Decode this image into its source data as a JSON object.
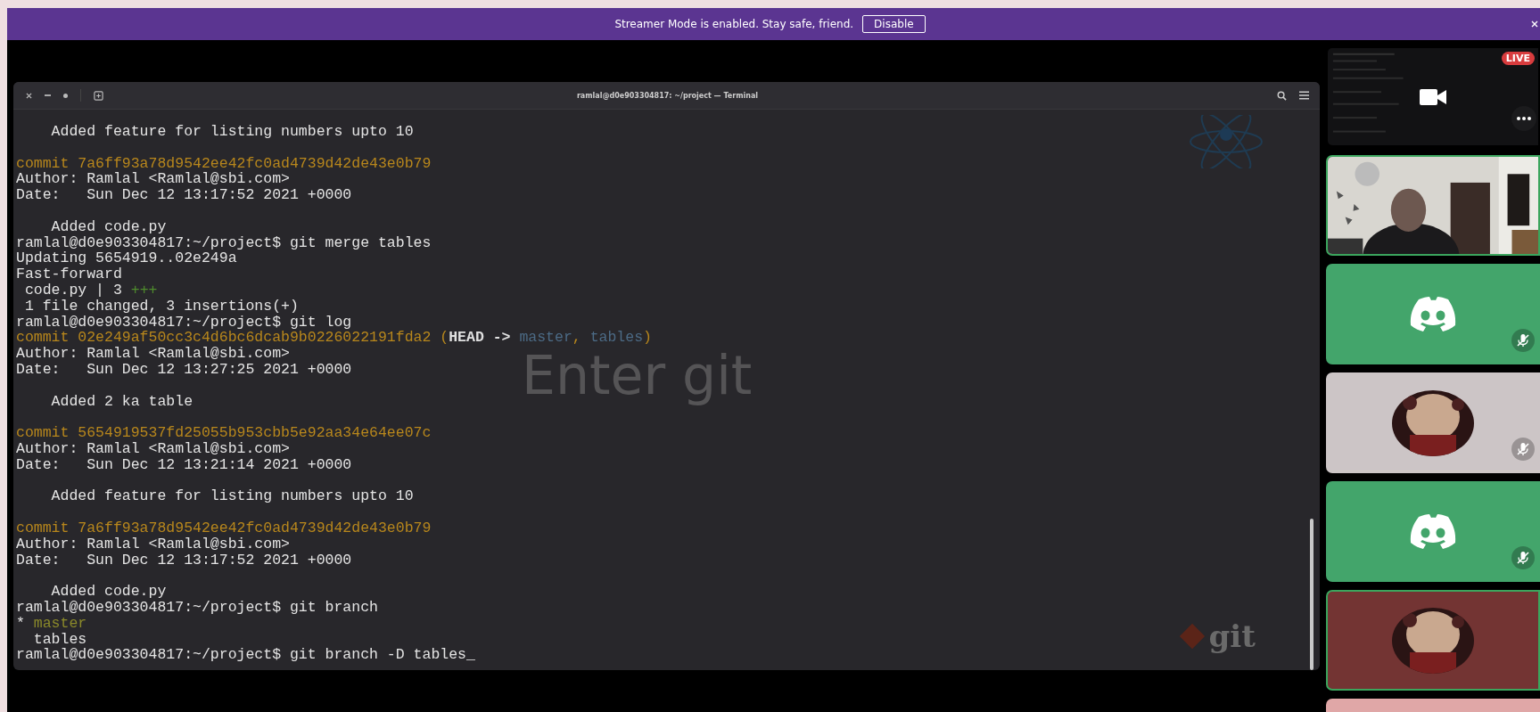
{
  "banner": {
    "message": "Streamer Mode is enabled. Stay safe, friend.",
    "button": "Disable"
  },
  "terminal": {
    "title": "ramlal@d0e903304817: ~/project — Terminal",
    "overlay_title": "Enter git",
    "logo_text": "git",
    "lines": [
      {
        "kind": "line",
        "segments": [
          {
            "kind": "text",
            "text": "    Added feature for listing numbers upto 10"
          }
        ]
      },
      {
        "kind": "blank"
      },
      {
        "kind": "line",
        "segments": [
          {
            "kind": "commit",
            "text": "commit 7a6ff93a78d9542ee42fc0ad4739d42de43e0b79"
          }
        ]
      },
      {
        "kind": "line",
        "segments": [
          {
            "kind": "text",
            "text": "Author: Ramlal <Ramlal@sbi.com>"
          }
        ]
      },
      {
        "kind": "line",
        "segments": [
          {
            "kind": "text",
            "text": "Date:   Sun Dec 12 13:17:52 2021 +0000"
          }
        ]
      },
      {
        "kind": "blank"
      },
      {
        "kind": "line",
        "segments": [
          {
            "kind": "text",
            "text": "    Added code.py"
          }
        ]
      },
      {
        "kind": "line",
        "segments": [
          {
            "kind": "text",
            "text": "ramlal@d0e903304817:~/project$ git merge tables"
          }
        ]
      },
      {
        "kind": "line",
        "segments": [
          {
            "kind": "text",
            "text": "Updating 5654919..02e249a"
          }
        ]
      },
      {
        "kind": "line",
        "segments": [
          {
            "kind": "text",
            "text": "Fast-forward"
          }
        ]
      },
      {
        "kind": "line",
        "segments": [
          {
            "kind": "text",
            "text": " code.py | 3 "
          },
          {
            "kind": "plus",
            "text": "+++"
          }
        ]
      },
      {
        "kind": "line",
        "segments": [
          {
            "kind": "text",
            "text": " 1 file changed, 3 insertions(+)"
          }
        ]
      },
      {
        "kind": "line",
        "segments": [
          {
            "kind": "text",
            "text": "ramlal@d0e903304817:~/project$ git log"
          }
        ]
      },
      {
        "kind": "line",
        "segments": [
          {
            "kind": "commit",
            "text": "commit 02e249af50cc3c4d6bc6dcab9b0226022191fda2 ("
          },
          {
            "kind": "head",
            "text": "HEAD -> "
          },
          {
            "kind": "ref",
            "text": "master"
          },
          {
            "kind": "commit",
            "text": ", "
          },
          {
            "kind": "ref",
            "text": "tables"
          },
          {
            "kind": "commit",
            "text": ")"
          }
        ]
      },
      {
        "kind": "line",
        "segments": [
          {
            "kind": "text",
            "text": "Author: Ramlal <Ramlal@sbi.com>"
          }
        ]
      },
      {
        "kind": "line",
        "segments": [
          {
            "kind": "text",
            "text": "Date:   Sun Dec 12 13:27:25 2021 +0000"
          }
        ]
      },
      {
        "kind": "blank"
      },
      {
        "kind": "line",
        "segments": [
          {
            "kind": "text",
            "text": "    Added 2 ka table"
          }
        ]
      },
      {
        "kind": "blank"
      },
      {
        "kind": "line",
        "segments": [
          {
            "kind": "commit",
            "text": "commit 5654919537fd25055b953cbb5e92aa34e64ee07c"
          }
        ]
      },
      {
        "kind": "line",
        "segments": [
          {
            "kind": "text",
            "text": "Author: Ramlal <Ramlal@sbi.com>"
          }
        ]
      },
      {
        "kind": "line",
        "segments": [
          {
            "kind": "text",
            "text": "Date:   Sun Dec 12 13:21:14 2021 +0000"
          }
        ]
      },
      {
        "kind": "blank"
      },
      {
        "kind": "line",
        "segments": [
          {
            "kind": "text",
            "text": "    Added feature for listing numbers upto 10"
          }
        ]
      },
      {
        "kind": "blank"
      },
      {
        "kind": "line",
        "segments": [
          {
            "kind": "commit",
            "text": "commit 7a6ff93a78d9542ee42fc0ad4739d42de43e0b79"
          }
        ]
      },
      {
        "kind": "line",
        "segments": [
          {
            "kind": "text",
            "text": "Author: Ramlal <Ramlal@sbi.com>"
          }
        ]
      },
      {
        "kind": "line",
        "segments": [
          {
            "kind": "text",
            "text": "Date:   Sun Dec 12 13:17:52 2021 +0000"
          }
        ]
      },
      {
        "kind": "blank"
      },
      {
        "kind": "line",
        "segments": [
          {
            "kind": "text",
            "text": "    Added code.py"
          }
        ]
      },
      {
        "kind": "line",
        "segments": [
          {
            "kind": "text",
            "text": "ramlal@d0e903304817:~/project$ git branch"
          }
        ]
      },
      {
        "kind": "line",
        "segments": [
          {
            "kind": "text",
            "text": "* "
          },
          {
            "kind": "current",
            "text": "master"
          }
        ]
      },
      {
        "kind": "line",
        "segments": [
          {
            "kind": "text",
            "text": "  tables"
          }
        ]
      },
      {
        "kind": "line",
        "segments": [
          {
            "kind": "text",
            "text": "ramlal@d0e903304817:~/project$ git branch -D tables_"
          }
        ]
      }
    ]
  },
  "tiles": [
    {
      "kind": "stream",
      "live_badge": "LIVE",
      "speaking": false
    },
    {
      "kind": "camera",
      "speaking": true
    },
    {
      "kind": "discord",
      "color": "#43a56b",
      "speaking": false,
      "muted": true
    },
    {
      "kind": "avatar",
      "color": "#ccc5c6",
      "speaking": false,
      "muted": true
    },
    {
      "kind": "discord",
      "color": "#43a56b",
      "speaking": false,
      "muted": true
    },
    {
      "kind": "avatar",
      "color": "#733433",
      "speaking": true
    },
    {
      "kind": "partial",
      "color": "#e0a7a7",
      "speaking": false
    }
  ]
}
